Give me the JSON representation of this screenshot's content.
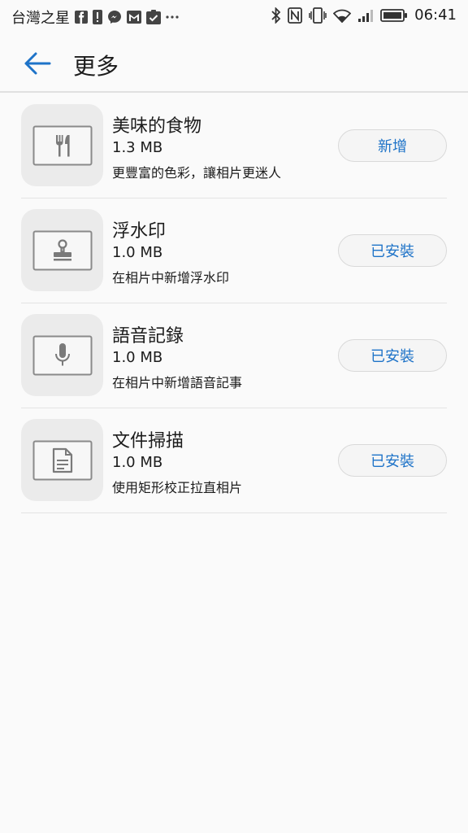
{
  "status_bar": {
    "carrier": "台灣之星",
    "time": "06:41"
  },
  "header": {
    "title": "更多"
  },
  "items": [
    {
      "title": "美味的食物",
      "size": "1.3 MB",
      "description": "更豐富的色彩，讓相片更迷人",
      "action": "新增",
      "icon": "fork-knife-icon"
    },
    {
      "title": "浮水印",
      "size": "1.0 MB",
      "description": "在相片中新增浮水印",
      "action": "已安裝",
      "icon": "stamp-icon"
    },
    {
      "title": "語音記錄",
      "size": "1.0 MB",
      "description": "在相片中新增語音記事",
      "action": "已安裝",
      "icon": "microphone-icon"
    },
    {
      "title": "文件掃描",
      "size": "1.0 MB",
      "description": "使用矩形校正拉直相片",
      "action": "已安裝",
      "icon": "document-icon"
    }
  ],
  "colors": {
    "accent": "#1e73c8",
    "background": "#fafafa",
    "thumb_bg": "#ebebeb",
    "icon_gray": "#7a7a7a"
  }
}
